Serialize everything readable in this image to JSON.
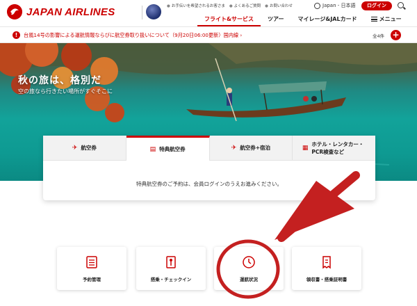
{
  "header": {
    "brand": "JAPAN AIRLINES",
    "util_links": [
      "お手伝いを希望されるお客さま",
      "よくあるご質問",
      "お問い合わせ"
    ],
    "language": "Japan - 日本語",
    "login_label": "ログイン",
    "nav": [
      {
        "label": "フライト&サービス",
        "active": true
      },
      {
        "label": "ツアー",
        "active": false
      },
      {
        "label": "マイレージ&JALカード",
        "active": false
      },
      {
        "label": "メニュー",
        "active": false
      }
    ]
  },
  "alert": {
    "message": "台風14号の影響による運航情報ならびに航空券取り扱いについて（9月20日06:00更新）国内線 ›",
    "count": "全4件",
    "plus": "+"
  },
  "hero": {
    "title": "秋の旅は、格別だ",
    "subtitle": "空の旅なら行きたい場所がすぐそこに"
  },
  "booking": {
    "tabs": [
      {
        "label": "航空券",
        "icon": "airplane-icon",
        "active": false
      },
      {
        "label": "特典航空券",
        "icon": "award-ticket-icon",
        "active": true
      },
      {
        "label": "航空券+宿泊",
        "icon": "plane-hotel-icon",
        "active": false
      },
      {
        "label": "ホテル・レンタカー・PCR検査など",
        "icon": "hotel-icon",
        "active": false
      }
    ],
    "message": "特典航空券のご予約は、会員ログインのうえお進みください。"
  },
  "quick_links": [
    {
      "label": "予約管理",
      "icon": "reservation-list-icon"
    },
    {
      "label": "搭乗・チェックイン",
      "icon": "boarding-gate-icon"
    },
    {
      "label": "運航状況",
      "icon": "clock-icon"
    },
    {
      "label": "領収書・搭乗証明書",
      "icon": "receipt-icon"
    }
  ],
  "colors": {
    "brand_red": "#cc0000",
    "annotation_red": "#c42020"
  }
}
